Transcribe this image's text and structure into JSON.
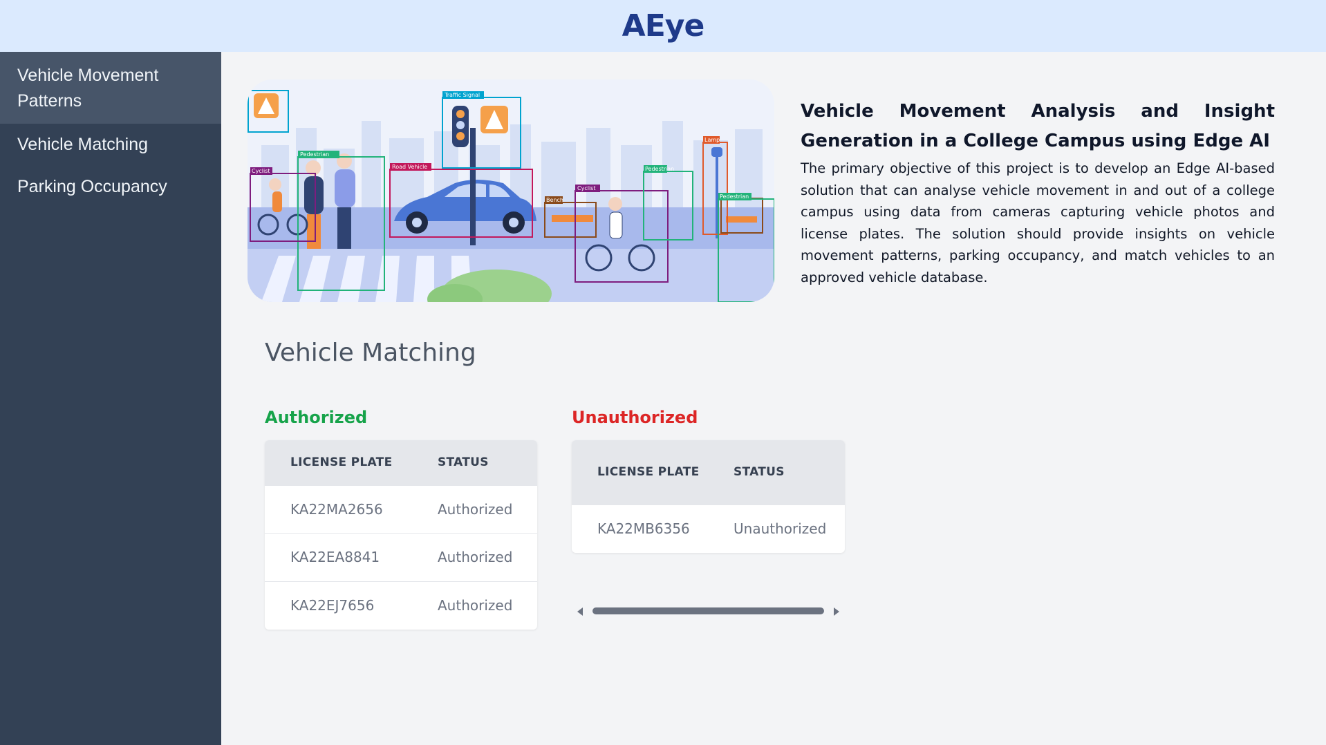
{
  "app": {
    "title": "AEye"
  },
  "sidebar": {
    "items": [
      {
        "label": "Vehicle Movement Patterns",
        "active": true
      },
      {
        "label": "Vehicle Matching",
        "active": false
      },
      {
        "label": "Parking Occupancy",
        "active": false
      }
    ]
  },
  "hero": {
    "labels": {
      "traffic_signal": "Traffic Signal",
      "pedestrian": "Pedestrian",
      "road_vehicle": "Road Vehicle",
      "cyclist": "Cyclist",
      "lamp": "Lamp",
      "bench": "Bench"
    }
  },
  "intro": {
    "title": "Vehicle Movement Analysis and Insight Generation in a College Campus using Edge AI",
    "text": "The primary objective of this project is to develop an Edge AI-based solution that can analyse vehicle movement in and out of a college campus using data from cameras capturing vehicle photos and license plates. The solution should provide insights on vehicle movement patterns, parking occupancy, and match vehicles to an approved vehicle database."
  },
  "matching": {
    "title": "Vehicle Matching",
    "authorized": {
      "heading": "Authorized",
      "color": "#16a34a",
      "columns": [
        "LICENSE PLATE",
        "STATUS"
      ],
      "rows": [
        {
          "plate": "KA22MA2656",
          "status": "Authorized"
        },
        {
          "plate": "KA22EA8841",
          "status": "Authorized"
        },
        {
          "plate": "KA22EJ7656",
          "status": "Authorized"
        }
      ]
    },
    "unauthorized": {
      "heading": "Unauthorized",
      "color": "#dc2626",
      "columns": [
        "LICENSE PLATE",
        "STATUS"
      ],
      "rows": [
        {
          "plate": "KA22MB6356",
          "status": "Unauthorized"
        }
      ]
    }
  }
}
